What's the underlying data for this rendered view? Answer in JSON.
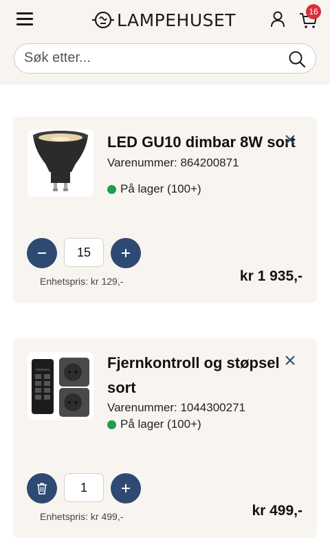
{
  "header": {
    "logo_text": "LAMPEHUSET",
    "cart_count": "16",
    "cart_badge_color": "#d6303a"
  },
  "search": {
    "placeholder": "Søk etter...",
    "value": ""
  },
  "icons": {
    "menu": "hamburger-menu-icon",
    "user": "user-icon",
    "cart": "shopping-cart-icon",
    "search": "search-icon",
    "remove": "close-icon",
    "decrease": "minus-icon",
    "increase": "plus-icon",
    "delete": "trash-icon"
  },
  "colors": {
    "accent": "#2e4a72",
    "in_stock": "#1f9d4a",
    "card_bg": "#f8f5f1"
  },
  "cart": {
    "items": [
      {
        "name": "LED GU10 dimbar 8W sort",
        "sku": "Varenummer: 864200871",
        "stock": "På lager (100+)",
        "quantity": "15",
        "unit_price": "Enhetspris: kr 129,-",
        "total": "kr 1 935,-"
      },
      {
        "name_line1": "Fjernkontroll og støpsel",
        "name_line2": "sort",
        "sku": "Varenummer: 1044300271",
        "stock": "På lager (100+)",
        "quantity": "1",
        "unit_price": "Enhetspris: kr 499,-",
        "total": "kr 499,-"
      }
    ]
  }
}
